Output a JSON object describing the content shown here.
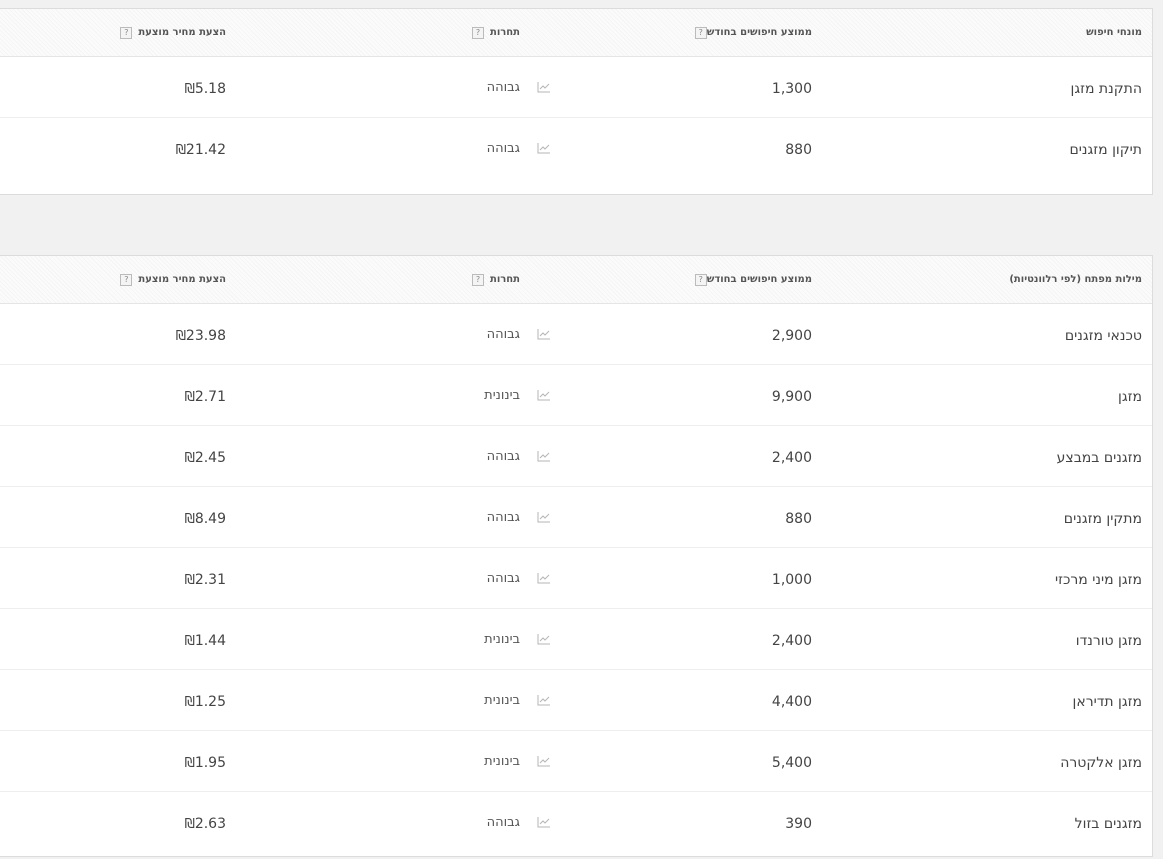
{
  "search_terms": {
    "headers": {
      "keyword": "מונחי חיפוש",
      "avg_searches": "ממוצע חיפושים בחודש",
      "competition": "תחרות",
      "suggested_bid": "הצעת מחיר מוצעת",
      "help_glyph": "?"
    },
    "rows": [
      {
        "keyword": "התקנת מזגן",
        "searches": "1,300",
        "competition": "גבוהה",
        "bid": "5.18",
        "currency": "₪"
      },
      {
        "keyword": "תיקון מזגנים",
        "searches": "880",
        "competition": "גבוהה",
        "bid": "21.42",
        "currency": "₪"
      }
    ]
  },
  "keyword_ideas": {
    "headers": {
      "keyword": "מילות מפתח (לפי רלוונטיות)",
      "avg_searches": "ממוצע חיפושים בחודש",
      "competition": "תחרות",
      "suggested_bid": "הצעת מחיר מוצעת",
      "help_glyph": "?"
    },
    "rows": [
      {
        "keyword": "טכנאי מזגנים",
        "searches": "2,900",
        "competition": "גבוהה",
        "bid": "23.98",
        "currency": "₪"
      },
      {
        "keyword": "מזגן",
        "searches": "9,900",
        "competition": "בינונית",
        "bid": "2.71",
        "currency": "₪"
      },
      {
        "keyword": "מזגנים במבצע",
        "searches": "2,400",
        "competition": "גבוהה",
        "bid": "2.45",
        "currency": "₪"
      },
      {
        "keyword": "מתקין מזגנים",
        "searches": "880",
        "competition": "גבוהה",
        "bid": "8.49",
        "currency": "₪"
      },
      {
        "keyword": "מזגן מיני מרכזי",
        "searches": "1,000",
        "competition": "גבוהה",
        "bid": "2.31",
        "currency": "₪"
      },
      {
        "keyword": "מזגן טורנדו",
        "searches": "2,400",
        "competition": "בינונית",
        "bid": "1.44",
        "currency": "₪"
      },
      {
        "keyword": "מזגן תדיראן",
        "searches": "4,400",
        "competition": "בינונית",
        "bid": "1.25",
        "currency": "₪"
      },
      {
        "keyword": "מזגן אלקטרה",
        "searches": "5,400",
        "competition": "בינונית",
        "bid": "1.95",
        "currency": "₪"
      },
      {
        "keyword": "מזגנים בזול",
        "searches": "390",
        "competition": "גבוהה",
        "bid": "2.63",
        "currency": "₪"
      }
    ]
  },
  "icons": {
    "trend": "trend-chart-icon",
    "help": "help-icon"
  }
}
